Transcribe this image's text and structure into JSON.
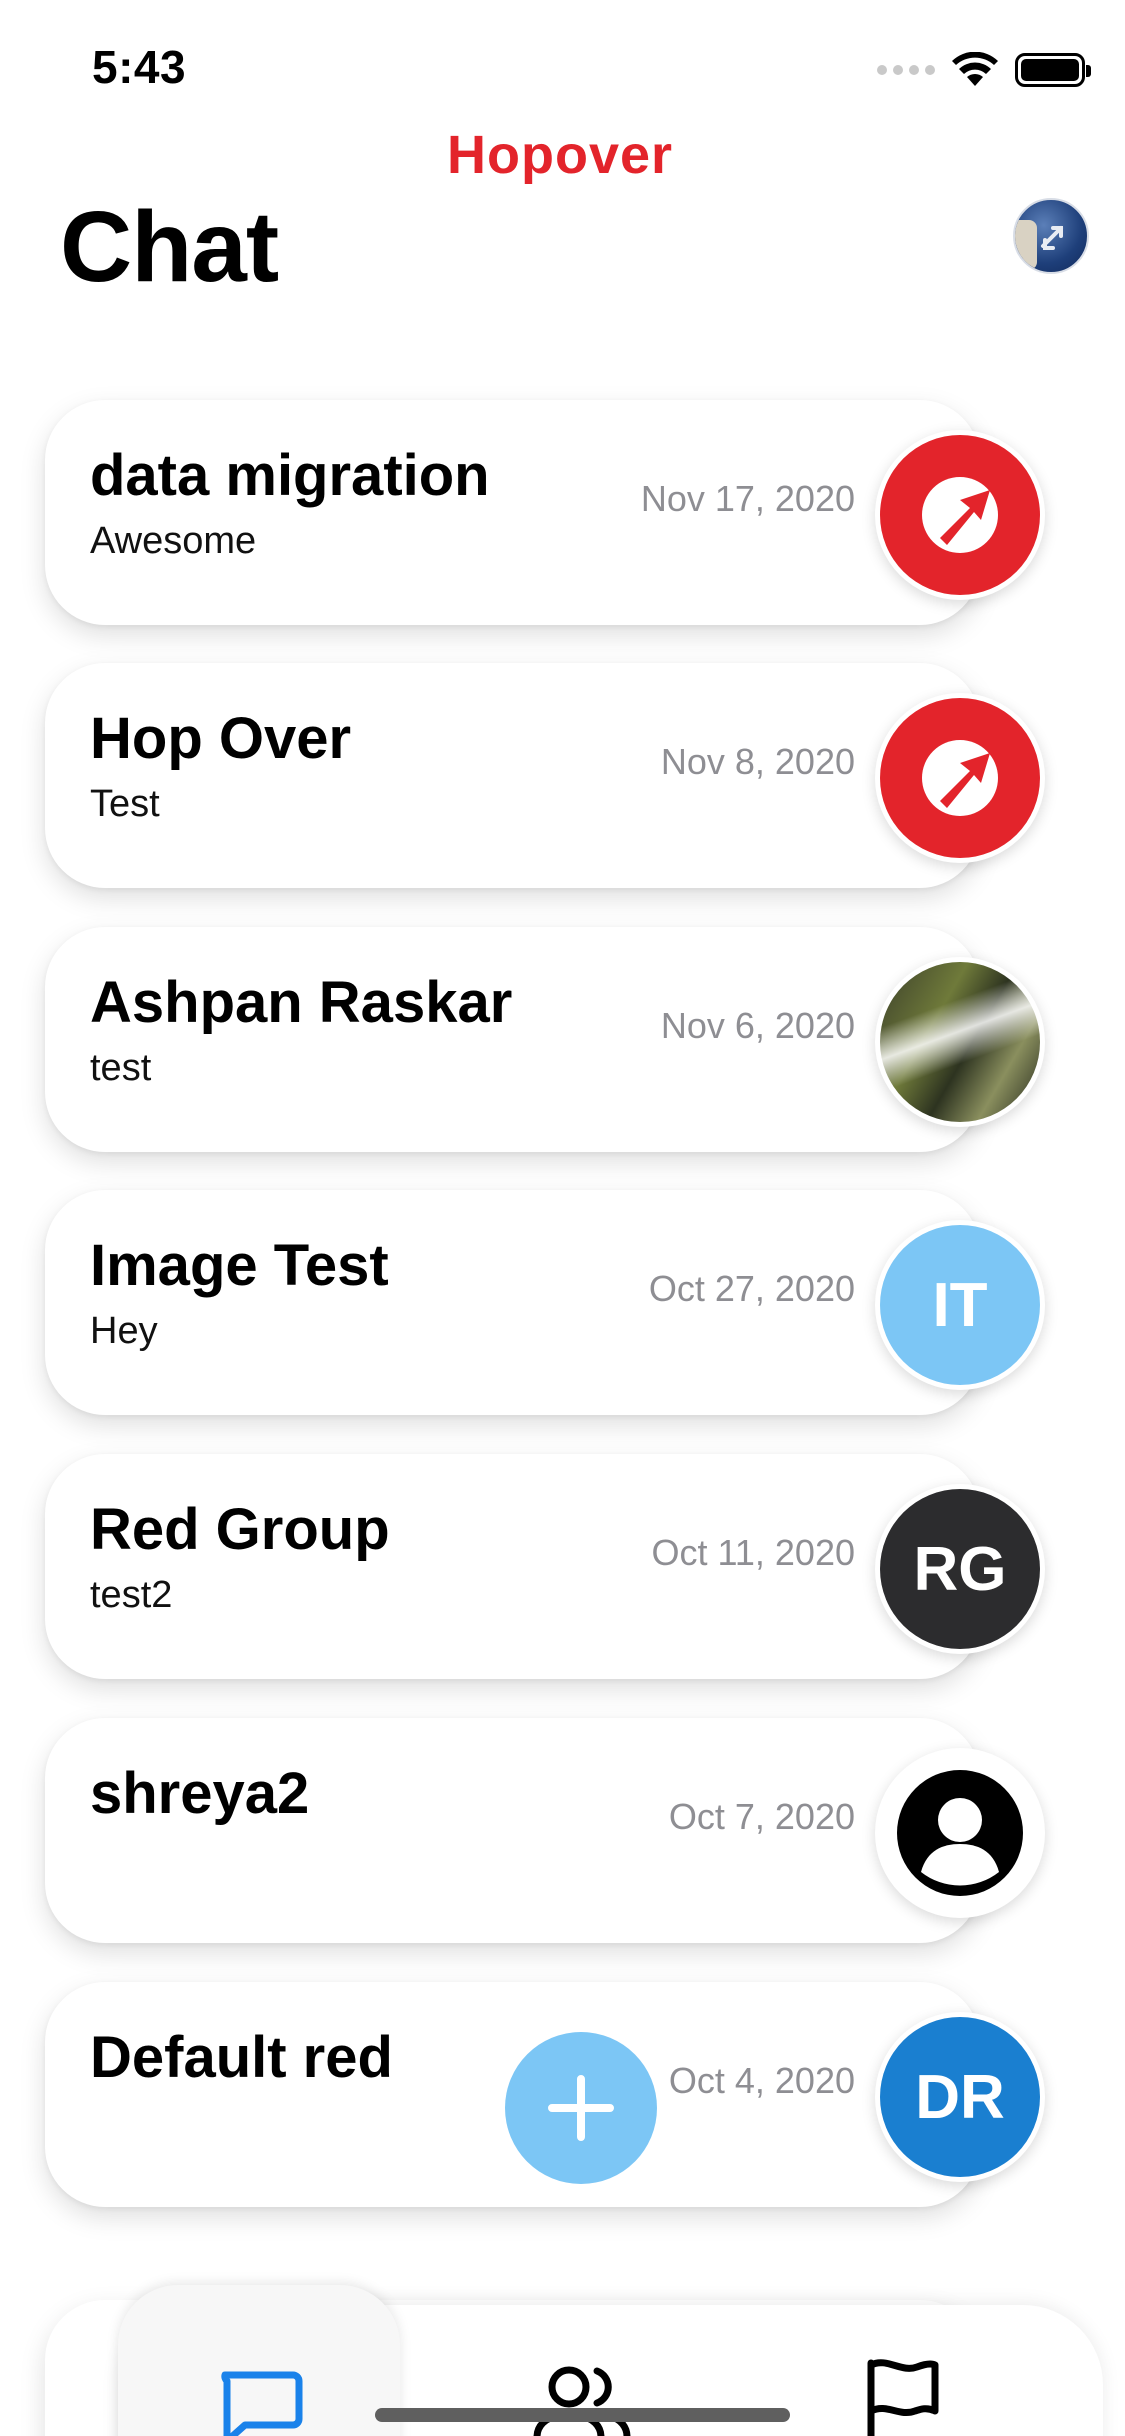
{
  "status_bar": {
    "time": "5:43"
  },
  "header": {
    "brand": "Hopover",
    "title": "Chat"
  },
  "chats": [
    {
      "title": "data migration",
      "preview": "Awesome",
      "date": "Nov 17, 2020",
      "avatar": {
        "type": "logo",
        "icon": "hopover-logo-icon"
      }
    },
    {
      "title": "Hop Over",
      "preview": "Test",
      "date": "Nov 8, 2020",
      "avatar": {
        "type": "logo",
        "icon": "hopover-logo-icon"
      }
    },
    {
      "title": "Ashpan Raskar",
      "preview": "test",
      "date": "Nov 6, 2020",
      "avatar": {
        "type": "photo",
        "icon": "waterfall-photo"
      }
    },
    {
      "title": "Image Test",
      "preview": "Hey",
      "date": "Oct 27, 2020",
      "avatar": {
        "type": "initials",
        "initials": "IT",
        "color": "#7cc6f5"
      }
    },
    {
      "title": "Red Group",
      "preview": "test2",
      "date": "Oct 11, 2020",
      "avatar": {
        "type": "initials",
        "initials": "RG",
        "color": "#2c2c2e"
      }
    },
    {
      "title": "shreya2",
      "preview": "",
      "date": "Oct 7, 2020",
      "avatar": {
        "type": "placeholder",
        "icon": "person-icon"
      }
    },
    {
      "title": "Default red",
      "preview": "",
      "date": "Oct 4, 2020",
      "avatar": {
        "type": "initials",
        "initials": "DR",
        "color": "#1a7fd0"
      }
    }
  ],
  "fab": {
    "icon": "plus-icon"
  },
  "tabs": [
    {
      "name": "chats",
      "icon": "chat-bubble-icon",
      "active": true
    },
    {
      "name": "people",
      "icon": "users-icon",
      "active": false
    },
    {
      "name": "reports",
      "icon": "flag-icon",
      "active": false
    }
  ],
  "colors": {
    "brand_red": "#e3242b",
    "accent_blue": "#1a7fd0",
    "light_blue": "#7cc6f5",
    "tab_active": "#1a82ea"
  }
}
